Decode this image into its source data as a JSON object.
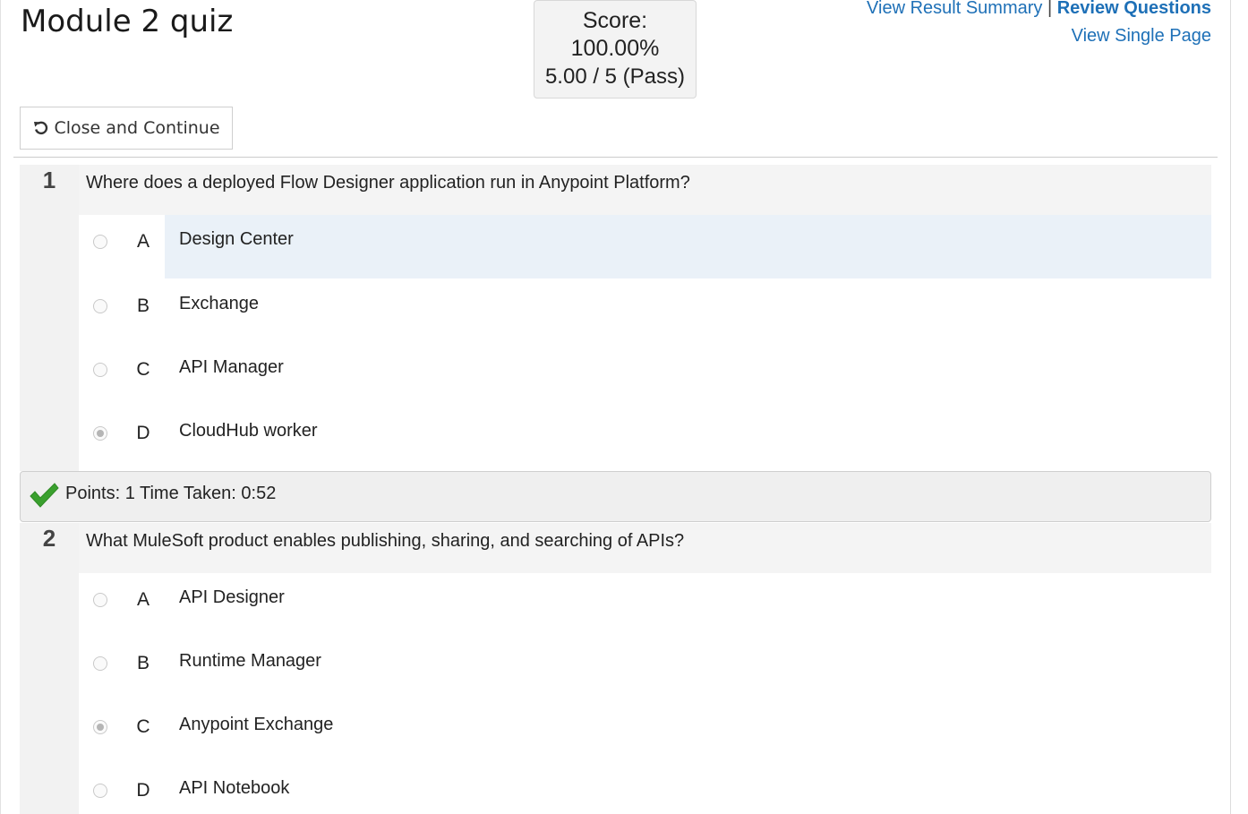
{
  "quiz": {
    "title": "Module 2 quiz",
    "score_label": "Score:",
    "score_percent": "100.00%",
    "score_detail": "5.00 / 5 (Pass)"
  },
  "links": {
    "view_result_summary": "View Result Summary",
    "separator": "|",
    "review_questions": "Review Questions",
    "view_single_page": "View Single Page"
  },
  "actions": {
    "close_and_continue": "Close and Continue"
  },
  "questions": [
    {
      "number": "1",
      "text": "Where does a deployed Flow Designer application run in Anypoint Platform?",
      "options": [
        {
          "letter": "A",
          "text": "Design Center",
          "selected": false,
          "highlighted": true
        },
        {
          "letter": "B",
          "text": "Exchange",
          "selected": false,
          "highlighted": false
        },
        {
          "letter": "C",
          "text": "API Manager",
          "selected": false,
          "highlighted": false
        },
        {
          "letter": "D",
          "text": "CloudHub worker",
          "selected": true,
          "highlighted": false
        }
      ],
      "result": "Points: 1 Time Taken: 0:52"
    },
    {
      "number": "2",
      "text": "What MuleSoft product enables publishing, sharing, and searching of APIs?",
      "options": [
        {
          "letter": "A",
          "text": "API Designer",
          "selected": false,
          "highlighted": false
        },
        {
          "letter": "B",
          "text": "Runtime Manager",
          "selected": false,
          "highlighted": false
        },
        {
          "letter": "C",
          "text": "Anypoint Exchange",
          "selected": true,
          "highlighted": false
        },
        {
          "letter": "D",
          "text": "API Notebook",
          "selected": false,
          "highlighted": false
        }
      ]
    }
  ],
  "icons": {
    "close_icon": "undo-arrow-icon",
    "result_icon": "checkmark-icon"
  },
  "colors": {
    "link": "#1e70b7",
    "check": "#3aa02e",
    "highlight": "#eaf1f8"
  }
}
